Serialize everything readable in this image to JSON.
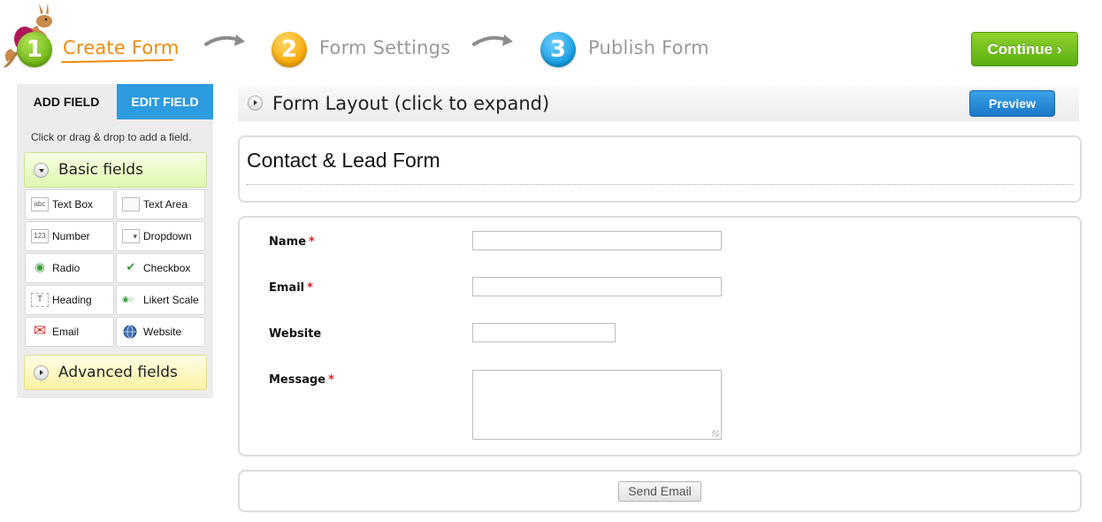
{
  "steps": [
    {
      "number": "1",
      "label": "Create Form"
    },
    {
      "number": "2",
      "label": "Form Settings"
    },
    {
      "number": "3",
      "label": "Publish Form"
    }
  ],
  "continue_label": "Continue ›",
  "colors": {
    "active_step": "#f08a0c",
    "continue_green": "#6fb514",
    "tab_blue": "#2d9be0",
    "required": "#dd2222"
  },
  "left_panel": {
    "tabs": {
      "add": "ADD FIELD",
      "edit": "EDIT FIELD"
    },
    "hint": "Click or drag & drop to add a field.",
    "basic_group": "Basic fields",
    "advanced_group": "Advanced fields",
    "fields": [
      {
        "label": "Text Box",
        "icon": "text-box-icon",
        "glyph": "abc"
      },
      {
        "label": "Text Area",
        "icon": "text-area-icon",
        "glyph": ""
      },
      {
        "label": "Number",
        "icon": "number-icon",
        "glyph": "123"
      },
      {
        "label": "Dropdown",
        "icon": "dropdown-icon",
        "glyph": "▾"
      },
      {
        "label": "Radio",
        "icon": "radio-icon",
        "glyph": "◉"
      },
      {
        "label": "Checkbox",
        "icon": "checkbox-icon",
        "glyph": "✔"
      },
      {
        "label": "Heading",
        "icon": "heading-icon",
        "glyph": "T"
      },
      {
        "label": "Likert Scale",
        "icon": "likert-scale-icon",
        "glyph": "◉○"
      },
      {
        "label": "Email",
        "icon": "email-icon",
        "glyph": "✉"
      },
      {
        "label": "Website",
        "icon": "globe-icon",
        "glyph": "●"
      }
    ]
  },
  "layout_bar": {
    "title": "Form Layout (click to expand)",
    "preview": "Preview"
  },
  "form": {
    "title": "Contact & Lead Form",
    "fields": [
      {
        "label": "Name",
        "required": true,
        "value": ""
      },
      {
        "label": "Email",
        "required": true,
        "value": ""
      },
      {
        "label": "Website",
        "required": false,
        "value": ""
      },
      {
        "label": "Message",
        "required": true,
        "value": ""
      }
    ],
    "required_mark": "*",
    "submit": "Send Email"
  }
}
